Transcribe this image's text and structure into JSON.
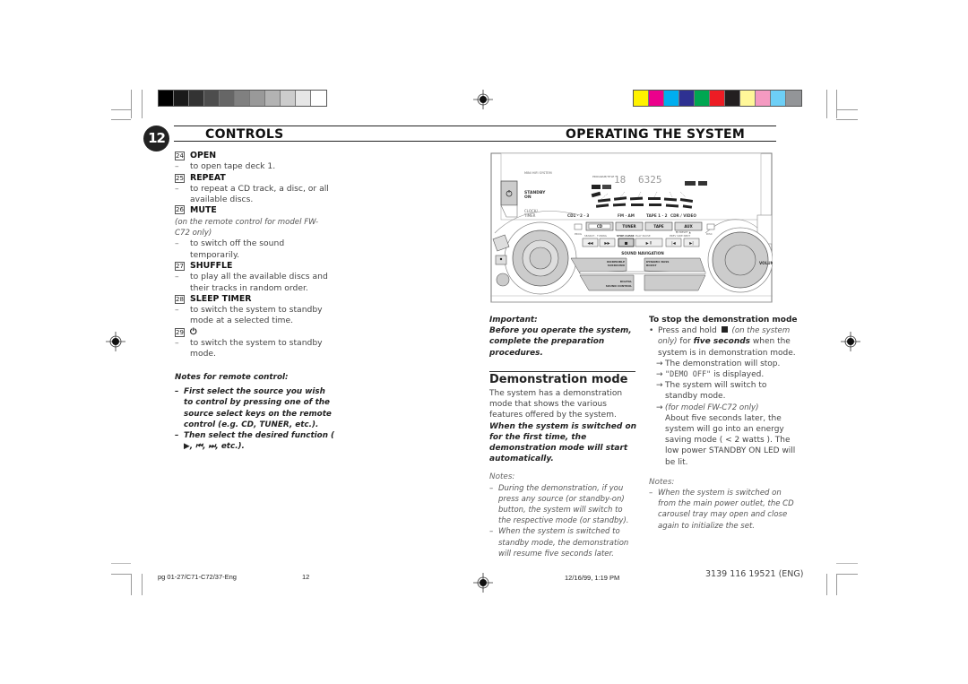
{
  "header": {
    "chapter_number": "12",
    "left_title": "CONTROLS",
    "right_title": "OPERATING THE SYSTEM"
  },
  "print_marks": {
    "grayscale_swatches": [
      "#000000",
      "#1a1a1a",
      "#333333",
      "#4d4d4d",
      "#666666",
      "#808080",
      "#999999",
      "#b3b3b3",
      "#cccccc",
      "#e6e6e6",
      "#ffffff"
    ],
    "color_swatches": [
      "#fff200",
      "#ec008c",
      "#00aeef",
      "#2e3192",
      "#00a651",
      "#ed1c24",
      "#231f20",
      "#fff799",
      "#f49ac1",
      "#6dcff6",
      "#939598"
    ]
  },
  "controls": [
    {
      "number": "24",
      "label": "OPEN",
      "note": "",
      "descriptions": [
        "to open tape deck 1."
      ]
    },
    {
      "number": "25",
      "label": "REPEAT",
      "note": "",
      "descriptions": [
        "to repeat a CD track, a disc, or all available discs."
      ]
    },
    {
      "number": "26",
      "label": "MUTE",
      "note": "(on the remote control for model FW-C72 only)",
      "descriptions": [
        "to switch off the sound temporarily."
      ]
    },
    {
      "number": "27",
      "label": "SHUFFLE",
      "note": "",
      "descriptions": [
        "to play all the available discs and their tracks in random order."
      ]
    },
    {
      "number": "28",
      "label": "SLEEP TIMER",
      "note": "",
      "descriptions": [
        "to switch the system to standby mode at a selected time."
      ]
    },
    {
      "number": "29",
      "label": "⏻",
      "note": "",
      "descriptions": [
        "to switch the system to standby mode."
      ]
    }
  ],
  "dash": "–",
  "remote_notes": {
    "title": "Notes for remote control:",
    "items": [
      "First select the source you wish to control by pressing one of the source select keys on the remote control (e.g.  CD, TUNER, etc.).",
      "Then select the desired function ( ▶,  ⏮,  ⏭,  etc.)."
    ]
  },
  "device": {
    "brand_line": "MINI HIFI SYSTEM",
    "standby": "STANDBY",
    "on": "ON",
    "clock_timer_1": "CLOCK/",
    "clock_timer_2": "TIMER",
    "display_digits": "6325",
    "display_small": "18",
    "sources_row": [
      "CD1 · 2 · 3",
      "FM · AM",
      "TAPE 1 · 2",
      "CDR / VIDEO"
    ],
    "source_buttons": [
      "CD",
      "TUNER",
      "TAPE",
      "AUX"
    ],
    "prog": "PROG",
    "disc": "DISC",
    "search_tuning": "SEARCH · TUNING",
    "stop_clear": "STOP·CLEAR",
    "play_pause": "PLAY  PAUSE",
    "preset": "▼ PRESET ▲",
    "prev_side_next": "PREV  SIDE  NEXT",
    "transport": [
      "◀◀",
      "▶▶",
      "■",
      "▶ II",
      "|◀",
      "▶|"
    ],
    "sound_navigation": "SOUND NAVIGATION",
    "incredible_surround_1": "INCREDIBLE",
    "incredible_surround_2": "SURROUND",
    "dynamic_bass_1": "DYNAMIC BASS",
    "dynamic_bass_2": "BOOST",
    "digital_sound_1": "DIGITAL",
    "digital_sound_2": "SOUND CONTROL",
    "volume": "VOLUME"
  },
  "important": {
    "label": "Important:",
    "text": "Before you operate the system, complete the preparation procedures."
  },
  "demo": {
    "title": "Demonstration mode",
    "intro_plain": "The system has a demonstration mode that shows the various features offered by the system. ",
    "intro_bold": "When the system is switched on for the first time, the demonstration mode will start automatically.",
    "notes_label": "Notes:",
    "notes": [
      "During the demonstration, if you press any source (or standby-on) button, the system will switch to the respective mode (or standby).",
      "When the system is switched to standby mode, the demonstration will resume five seconds later."
    ]
  },
  "stop_demo": {
    "title": "To stop the demonstration mode",
    "bullet": "•",
    "press_hold": "Press and hold",
    "system_only": "(on the system only)",
    "for": "for",
    "five_seconds": "five seconds",
    "when_in": "when the system is in demonstration mode.",
    "arrow": "→",
    "results": [
      "The demonstration will stop.",
      "The system will switch to standby mode."
    ],
    "display_text": "\"DEMO  OFF\"",
    "is_displayed": "is displayed.",
    "model_note": "(for model FW-C72 only)",
    "energy_text": "About five seconds later, the system will go into an energy saving mode ( < 2 watts ). The low power STANDBY ON LED will be lit.",
    "notes_label": "Notes:",
    "notes": [
      "When the system is switched on from the main power outlet, the CD carousel tray may open and close again to initialize the set."
    ]
  },
  "footer": {
    "file": "pg 01-27/C71-C72/37-Eng",
    "page": "12",
    "date": "12/16/99, 1:19 PM",
    "code": "3139 116 19521 (ENG)"
  }
}
